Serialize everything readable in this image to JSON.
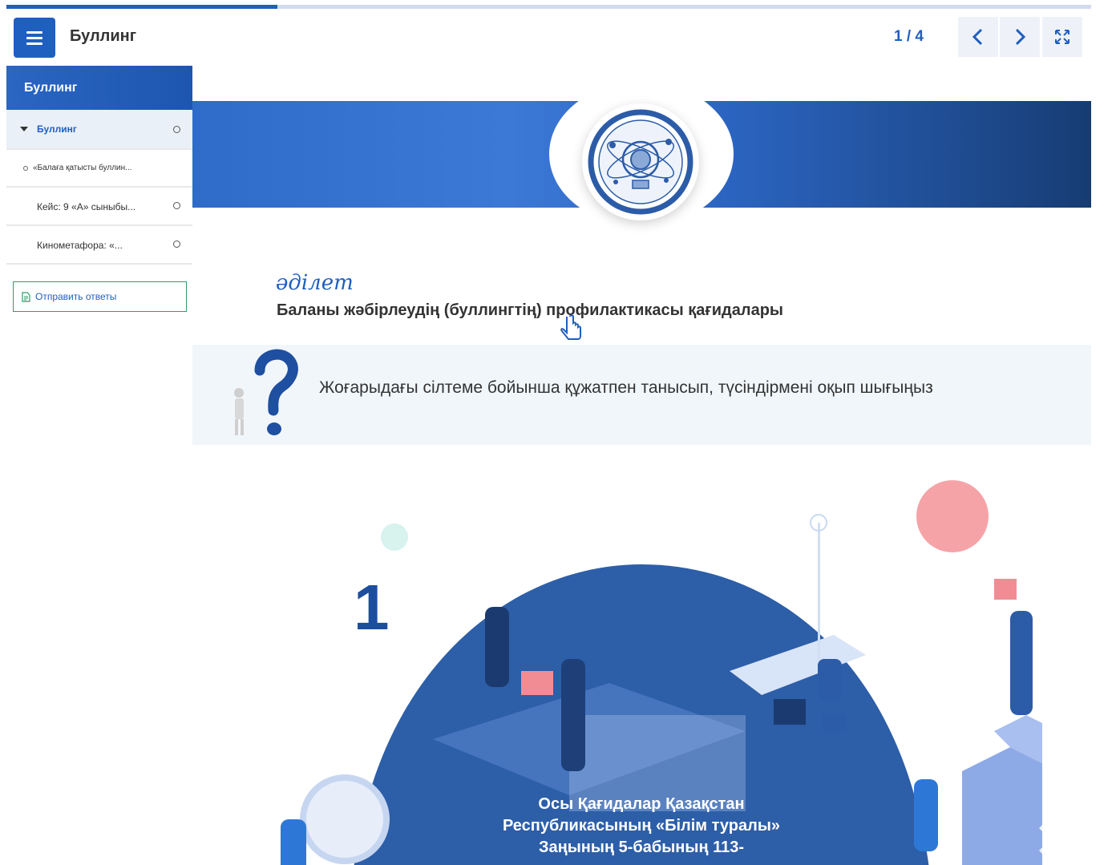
{
  "app": {
    "title": "Буллинг"
  },
  "header": {
    "page_counter": "1 / 4"
  },
  "progress": {
    "fraction": 0.25
  },
  "sidebar": {
    "heading": "Буллинг",
    "items": [
      {
        "label": "Буллинг",
        "active": true
      },
      {
        "label": "«Балаға қатысты буллин..."
      },
      {
        "label": "Кейс: 9 «А» сыныбы..."
      },
      {
        "label": "Кинометафора: «..."
      }
    ],
    "send_button": "Отправить ответы"
  },
  "content": {
    "adilet_logo": "әділет",
    "document_link": "Баланы жәбірлеудің (буллингтің) профилактикасы қағидалары",
    "instruction": "Жоғарыдағы сілтеме бойынша құжатпен танысып, түсіндірмені оқып шығыңыз",
    "slide_number": "1",
    "illustration_text": "Осы Қағидалар Қазақстан Республикасының «Білім туралы» Заңының 5-бабының 113-"
  },
  "colors": {
    "accent": "#1f5fbf",
    "banner_dark": "#163c72",
    "send_border": "#2e9c6a",
    "info_bg": "#f1f6fb"
  },
  "icons": [
    "menu-icon",
    "chevron-left-icon",
    "chevron-right-icon",
    "fullscreen-icon",
    "caret-down-icon",
    "document-icon",
    "question-mark-icon",
    "hand-cursor-icon"
  ]
}
